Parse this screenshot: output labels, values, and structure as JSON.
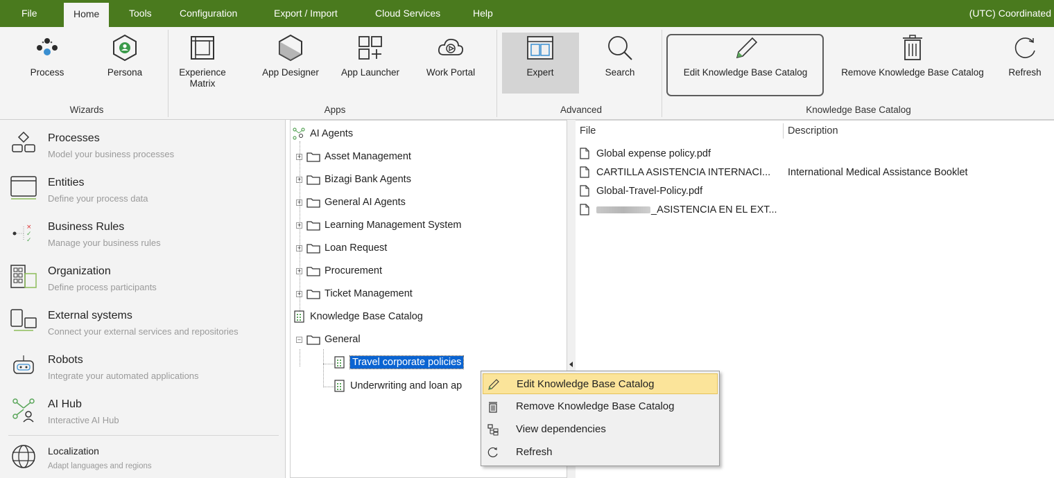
{
  "menubar": {
    "items": [
      "File",
      "Home",
      "Tools",
      "Configuration",
      "Export / Import",
      "Cloud Services",
      "Help"
    ],
    "active": "Home",
    "timezone": "(UTC) Coordinated"
  },
  "ribbon": {
    "wizards": {
      "process": "Process",
      "persona": "Persona",
      "group": "Wizards"
    },
    "apps": {
      "experience_matrix_1": "Experience",
      "experience_matrix_2": "Matrix",
      "app_designer": "App Designer",
      "app_launcher": "App Launcher",
      "work_portal": "Work Portal",
      "group": "Apps"
    },
    "advanced": {
      "expert": "Expert",
      "search": "Search",
      "group": "Advanced"
    },
    "kb": {
      "edit": "Edit Knowledge Base Catalog",
      "remove": "Remove Knowledge Base Catalog",
      "refresh": "Refresh",
      "group": "Knowledge Base Catalog"
    }
  },
  "leftnav": {
    "items": [
      {
        "title": "Processes",
        "subtitle": "Model your business processes"
      },
      {
        "title": "Entities",
        "subtitle": "Define your process data"
      },
      {
        "title": "Business Rules",
        "subtitle": "Manage your business rules"
      },
      {
        "title": "Organization",
        "subtitle": "Define process participants"
      },
      {
        "title": "External systems",
        "subtitle": "Connect your external services and repositories"
      },
      {
        "title": "Robots",
        "subtitle": "Integrate your automated applications"
      },
      {
        "title": "AI Hub",
        "subtitle": "Interactive AI Hub"
      },
      {
        "title": "Localization",
        "subtitle": "Adapt languages and regions"
      }
    ]
  },
  "tree": {
    "root": "AI Agents",
    "folders": [
      "Asset Management",
      "Bizagi Bank Agents",
      "General AI Agents",
      "Learning Management System",
      "Loan Request",
      "Procurement",
      "Ticket Management"
    ],
    "kb_root": "Knowledge Base Catalog",
    "kb_folder": "General",
    "kb_items": [
      "Travel corporate policies",
      "Underwriting and loan ap"
    ]
  },
  "filelist": {
    "col_file": "File",
    "col_description": "Description",
    "rows": [
      {
        "file": "Global expense policy.pdf",
        "description": ""
      },
      {
        "file": "CARTILLA ASISTENCIA INTERNACI...",
        "description": "International Medical Assistance Booklet"
      },
      {
        "file": "Global-Travel-Policy.pdf",
        "description": ""
      },
      {
        "file": "_ASISTENCIA EN EL EXT...",
        "description": ""
      }
    ]
  },
  "contextmenu": {
    "items": [
      "Edit Knowledge Base Catalog",
      "Remove Knowledge Base Catalog",
      "View dependencies",
      "Refresh"
    ]
  },
  "colors": {
    "brand_green": "#4a7a1e",
    "selection": "#0a64d2",
    "hover": "#fbe49a"
  }
}
